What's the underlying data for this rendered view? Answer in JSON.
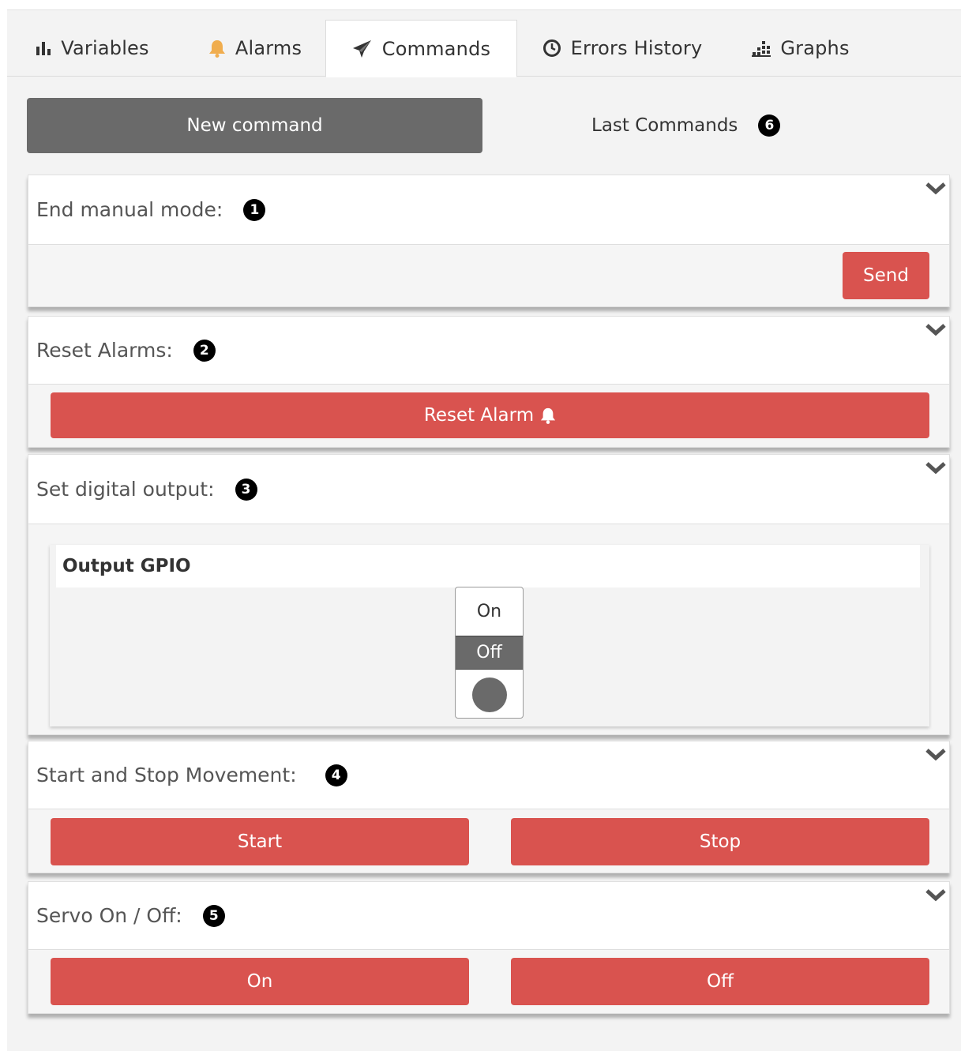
{
  "tabs": [
    {
      "label": "Variables",
      "icon": "bar-chart-icon"
    },
    {
      "label": "Alarms",
      "icon": "bell-icon",
      "icon_color": "#f0ad4e"
    },
    {
      "label": "Commands",
      "icon": "paper-plane-icon",
      "active": true
    },
    {
      "label": "Errors History",
      "icon": "clock-icon"
    },
    {
      "label": "Graphs",
      "icon": "dotted-chart-icon"
    }
  ],
  "header": {
    "new_command_label": "New command",
    "last_commands_label": "Last Commands",
    "last_commands_marker": "6"
  },
  "panels": {
    "end_manual_mode": {
      "title": "End manual mode:",
      "marker": "1",
      "send_label": "Send"
    },
    "reset_alarms": {
      "title": "Reset Alarms:",
      "marker": "2",
      "button_label": "Reset Alarm"
    },
    "set_digital_output": {
      "title": "Set digital output:",
      "marker": "3",
      "card_title": "Output GPIO",
      "toggle_on": "On",
      "toggle_off": "Off",
      "selected": "Off"
    },
    "start_stop": {
      "title": "Start and Stop Movement:",
      "marker": "4",
      "start_label": "Start",
      "stop_label": "Stop"
    },
    "servo": {
      "title": "Servo On / Off:",
      "marker": "5",
      "on_label": "On",
      "off_label": "Off"
    }
  },
  "colors": {
    "accent_red": "#d9534f",
    "dark_button": "#6a6a6a",
    "bell": "#f0ad4e"
  }
}
